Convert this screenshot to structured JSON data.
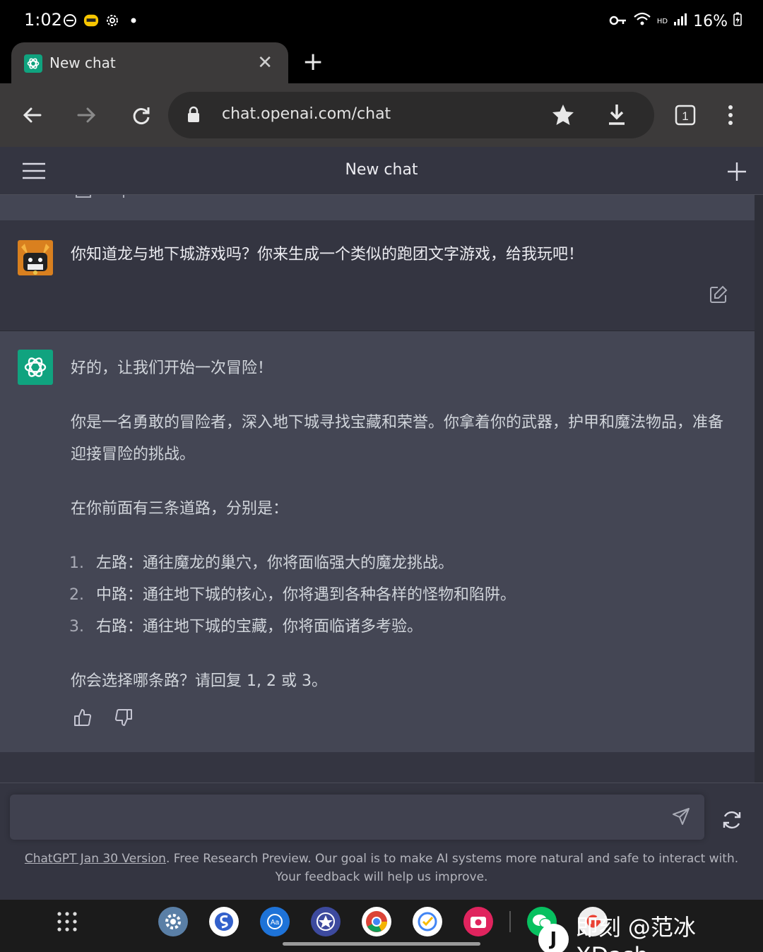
{
  "status_bar": {
    "time": "1:02",
    "battery": "16%",
    "network_badge": "HD"
  },
  "browser": {
    "tab_title": "New chat",
    "url": "chat.openai.com/chat",
    "tab_count": "1"
  },
  "app": {
    "header_title": "New chat"
  },
  "conversation": {
    "user_message": "你知道龙与地下城游戏吗？你来生成一个类似的跑团文字游戏，给我玩吧！",
    "assistant": {
      "intro": "好的，让我们开始一次冒险！",
      "paragraph": "你是一名勇敢的冒险者，深入地下城寻找宝藏和荣誉。你拿着你的武器，护甲和魔法物品，准备迎接冒险的挑战。",
      "paths_intro": "在你前面有三条道路，分别是：",
      "options": [
        {
          "num": "1.",
          "text": "左路：通往魔龙的巢穴，你将面临强大的魔龙挑战。"
        },
        {
          "num": "2.",
          "text": "中路：通往地下城的核心，你将遇到各种各样的怪物和陷阱。"
        },
        {
          "num": "3.",
          "text": "右路：通往地下城的宝藏，你将面临诸多考验。"
        }
      ],
      "question": "你会选择哪条路？请回复 1, 2 或 3。"
    }
  },
  "footer": {
    "version_link": "ChatGPT Jan 30 Version",
    "note": ". Free Research Preview. Our goal is to make AI systems more natural and safe to interact with. Your feedback will help us improve."
  },
  "watermark": {
    "logo_letter": "J",
    "text": "即刻 @范冰XDash"
  },
  "colors": {
    "chat_bg": "#343541",
    "assistant_bg": "#444654",
    "accent": "#10a37f"
  }
}
